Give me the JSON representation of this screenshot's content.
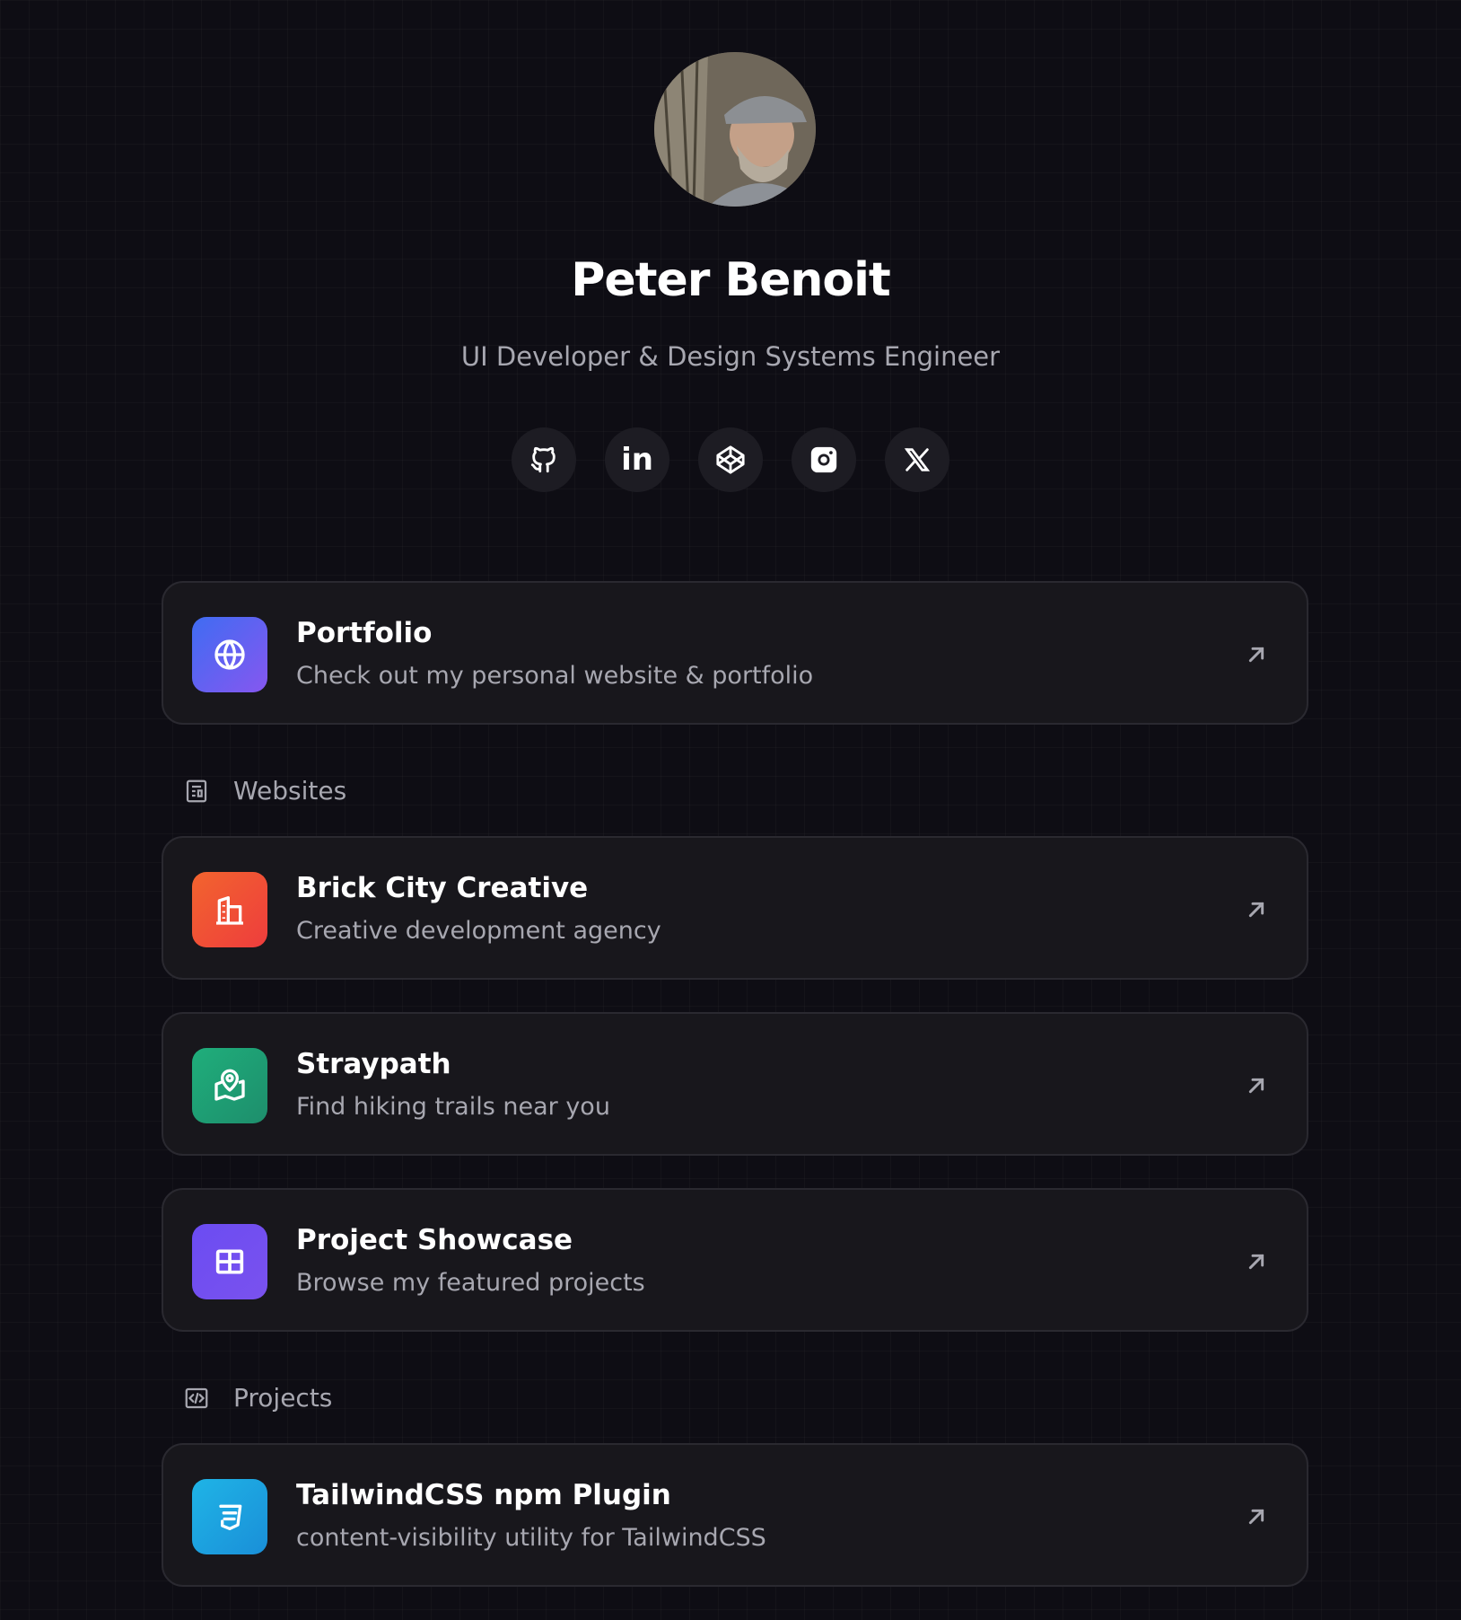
{
  "profile": {
    "name": "Peter Benoit",
    "tagline": "UI Developer & Design Systems Engineer"
  },
  "socials": [
    {
      "icon": "github-icon"
    },
    {
      "icon": "linkedin-icon",
      "glyph": "in"
    },
    {
      "icon": "codepen-icon"
    },
    {
      "icon": "instagram-icon"
    },
    {
      "icon": "x-icon"
    }
  ],
  "featured": {
    "title": "Portfolio",
    "description": "Check out my personal website & portfolio",
    "icon": "globe-icon",
    "color": "#5b5ef0"
  },
  "sections": {
    "websites": "Websites",
    "projects": "Projects"
  },
  "websites": [
    {
      "title": "Brick City Creative",
      "description": "Creative development agency",
      "icon": "building-icon",
      "color": "#f0512f"
    },
    {
      "title": "Straypath",
      "description": "Find hiking trails near you",
      "icon": "map-pin-icon",
      "color": "#1fa075"
    },
    {
      "title": "Project Showcase",
      "description": "Browse my featured projects",
      "icon": "grid-icon",
      "color": "#6a4ef2"
    }
  ],
  "projects": [
    {
      "title": "TailwindCSS npm Plugin",
      "description": "content-visibility utility for TailwindCSS",
      "icon": "css-icon",
      "color": "#1c9ede"
    }
  ]
}
